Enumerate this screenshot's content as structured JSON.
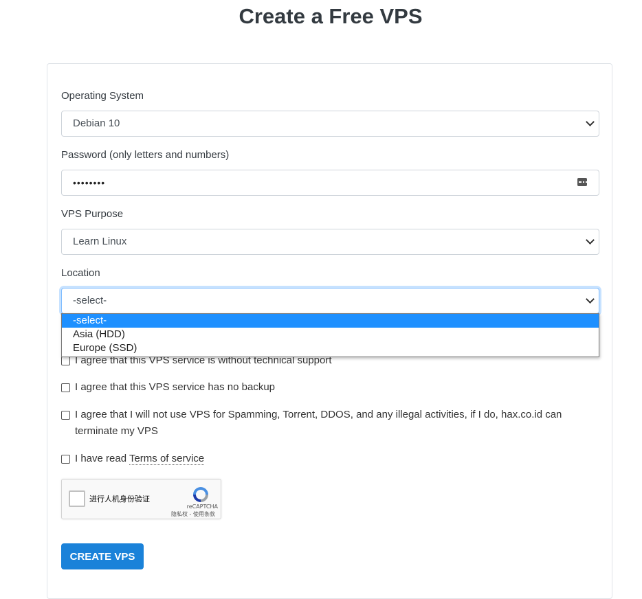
{
  "page": {
    "title": "Create a Free VPS"
  },
  "form": {
    "os": {
      "label": "Operating System",
      "value": "Debian 10"
    },
    "password": {
      "label": "Password (only letters and numbers)",
      "value": "••••••••"
    },
    "purpose": {
      "label": "VPS Purpose",
      "value": "Learn Linux"
    },
    "location": {
      "label": "Location",
      "value": "-select-",
      "options": [
        "-select-",
        "Asia (HDD)",
        "Europe (SSD)"
      ]
    },
    "agreements": [
      {
        "text": "I agree that this VPS service is without technical support"
      },
      {
        "text": "I agree that this VPS service has no backup"
      },
      {
        "text": "I agree that I will not use VPS for Spamming, Torrent, DDOS, and any illegal activities, if I do, hax.co.id can terminate my VPS"
      }
    ],
    "tos": {
      "prefix": "I have read ",
      "link": "Terms of service"
    },
    "recaptcha": {
      "label": "进行人机身份验证",
      "brand": "reCAPTCHA",
      "links": "隐私权 - 使用条款"
    },
    "submit_label": "CREATE VPS"
  },
  "colors": {
    "accent": "#1a82d9",
    "dropdown_selected": "#1e90ff"
  }
}
